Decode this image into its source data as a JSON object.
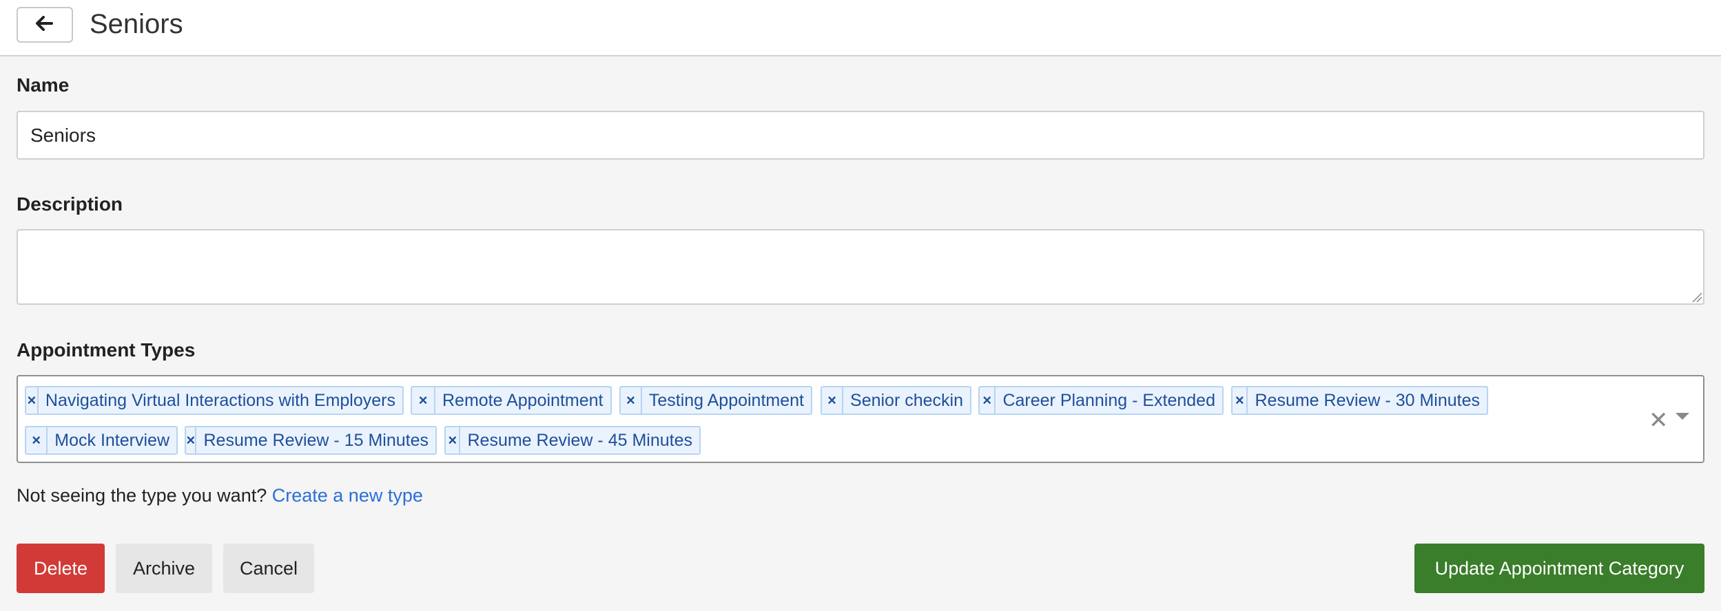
{
  "header": {
    "title": "Seniors",
    "back_icon": "arrow-left-icon"
  },
  "form": {
    "name_label": "Name",
    "name_value": "Seniors",
    "description_label": "Description",
    "description_value": "",
    "appointment_types_label": "Appointment Types",
    "appointment_types": [
      "Navigating Virtual Interactions with Employers",
      "Remote Appointment",
      "Testing Appointment",
      "Senior checkin",
      "Career Planning - Extended",
      "Resume Review - 30 Minutes",
      "Mock Interview",
      "Resume Review - 15 Minutes",
      "Resume Review - 45 Minutes"
    ],
    "chip_remove_glyph": "×",
    "clear_all_glyph": "✕",
    "hint_text": "Not seeing the type you want?",
    "hint_link": "Create a new type"
  },
  "actions": {
    "delete_label": "Delete",
    "archive_label": "Archive",
    "cancel_label": "Cancel",
    "update_label": "Update Appointment Category"
  },
  "colors": {
    "delete": "#d13a36",
    "update": "#3a7d2a",
    "chip_bg": "#eaf3fd",
    "chip_text": "#1e4f9c",
    "link": "#2a6fd6"
  }
}
